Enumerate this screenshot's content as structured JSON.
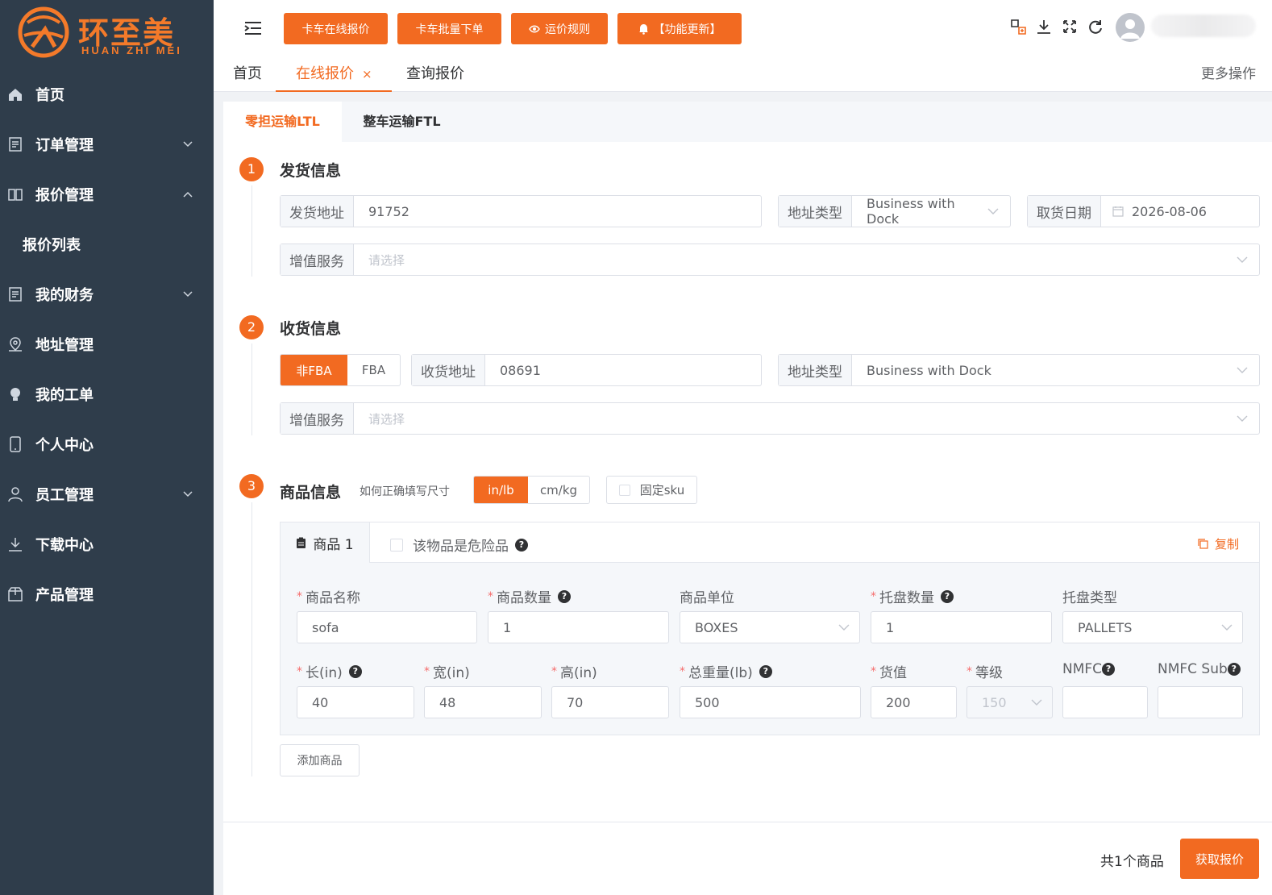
{
  "brand": {
    "cn": "环至美",
    "en": "HUAN ZHI MEI",
    "accent": "#f26a21"
  },
  "sidebar": {
    "items": [
      {
        "label": "首页",
        "icon": "home-icon"
      },
      {
        "label": "订单管理",
        "icon": "document-icon"
      },
      {
        "label": "报价管理",
        "icon": "book-icon"
      },
      {
        "label": "报价列表"
      },
      {
        "label": "我的财务",
        "icon": "document-icon"
      },
      {
        "label": "地址管理",
        "icon": "map-pin-icon"
      },
      {
        "label": "我的工单",
        "icon": "lightbulb-icon"
      },
      {
        "label": "个人中心",
        "icon": "phone-icon"
      },
      {
        "label": "员工管理",
        "icon": "user-icon"
      },
      {
        "label": "下载中心",
        "icon": "download-icon"
      },
      {
        "label": "产品管理",
        "icon": "box-icon"
      }
    ]
  },
  "header": {
    "buttons": [
      "卡车在线报价",
      "卡车批量下单",
      "运价规则",
      "【功能更新】"
    ]
  },
  "page_tabs": {
    "items": [
      "首页",
      "在线报价",
      "查询报价"
    ],
    "more": "更多操作"
  },
  "sub_tabs": [
    "零担运输LTL",
    "整车运输FTL"
  ],
  "shipper": {
    "title": "发货信息",
    "address_label": "发货地址",
    "address_value": "91752",
    "addr_type_label": "地址类型",
    "addr_type_value": "Business with Dock",
    "date_label": "取货日期",
    "date_value": "2026-08-06",
    "service_label": "增值服务",
    "service_placeholder": "请选择"
  },
  "receiver": {
    "title": "收货信息",
    "seg": [
      "非FBA",
      "FBA"
    ],
    "address_label": "收货地址",
    "address_value": "08691",
    "addr_type_label": "地址类型",
    "addr_type_value": "Business with Dock",
    "service_label": "增值服务",
    "service_placeholder": "请选择"
  },
  "goods": {
    "title": "商品信息",
    "howto": "如何正确填写尺寸",
    "units": [
      "in/lb",
      "cm/kg"
    ],
    "fixed_sku": "固定sku",
    "item_tab": "商品 1",
    "dangerous": "该物品是危险品",
    "copy": "复制",
    "labels": {
      "name": "商品名称",
      "qty": "商品数量",
      "unit": "商品单位",
      "pallet_qty": "托盘数量",
      "pallet_type": "托盘类型",
      "length": "长(in)",
      "width": "宽(in)",
      "height": "高(in)",
      "weight": "总重量(lb)",
      "value": "货值",
      "class": "等级",
      "nmfc": "NMFC",
      "nmfc_sub": "NMFC Sub"
    },
    "values": {
      "name": "sofa",
      "qty": "1",
      "unit": "BOXES",
      "pallet_qty": "1",
      "pallet_type": "PALLETS",
      "length": "40",
      "width": "48",
      "height": "70",
      "weight": "500",
      "value": "200",
      "class": "150",
      "nmfc": "",
      "nmfc_sub": ""
    },
    "add_button": "添加商品"
  },
  "footer": {
    "total": "共1个商品",
    "quote_button": "获取报价"
  },
  "step_numbers": [
    "1",
    "2",
    "3"
  ],
  "close_mark": "×"
}
